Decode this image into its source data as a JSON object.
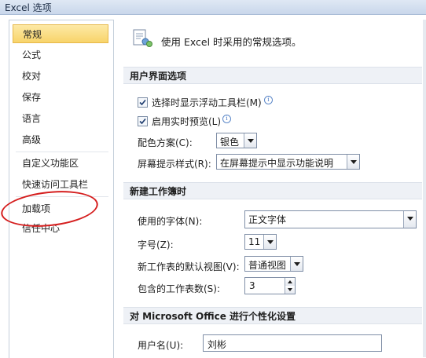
{
  "window": {
    "title": "Excel 选项"
  },
  "colors": {
    "selected_bg": "#f8d46a",
    "annotation": "#d51e1e",
    "section_bg": "#eef1f6"
  },
  "sidebar": {
    "items": [
      {
        "label": "常规",
        "selected": true
      },
      {
        "label": "公式"
      },
      {
        "label": "校对"
      },
      {
        "label": "保存"
      },
      {
        "label": "语言"
      },
      {
        "label": "高级"
      },
      {
        "label": "自定义功能区"
      },
      {
        "label": "快速访问工具栏"
      },
      {
        "label": "加载项"
      },
      {
        "label": "信任中心"
      }
    ]
  },
  "main": {
    "header": {
      "icon": "general-options-icon",
      "text": "使用 Excel 时采用的常规选项。"
    },
    "ui_section": {
      "title": "用户界面选项",
      "mini_toolbar": {
        "label": "选择时显示浮动工具栏(M)",
        "checked": true,
        "info_glyph": "i"
      },
      "live_preview": {
        "label": "启用实时预览(L)",
        "checked": true,
        "info_glyph": "i"
      },
      "color_scheme": {
        "label": "配色方案(C):",
        "value": "银色"
      },
      "screentip": {
        "label": "屏幕提示样式(R):",
        "value": "在屏幕提示中显示功能说明"
      }
    },
    "new_workbook_section": {
      "title": "新建工作簿时",
      "font": {
        "label": "使用的字体(N):",
        "value": "正文字体"
      },
      "font_size": {
        "label": "字号(Z):",
        "value": "11"
      },
      "default_view": {
        "label": "新工作表的默认视图(V):",
        "value": "普通视图"
      },
      "sheet_count": {
        "label": "包含的工作表数(S):",
        "value": "3"
      }
    },
    "personalize_section": {
      "title": "对 Microsoft Office 进行个性化设置",
      "username": {
        "label": "用户名(U):",
        "value": "刘彬"
      }
    }
  }
}
